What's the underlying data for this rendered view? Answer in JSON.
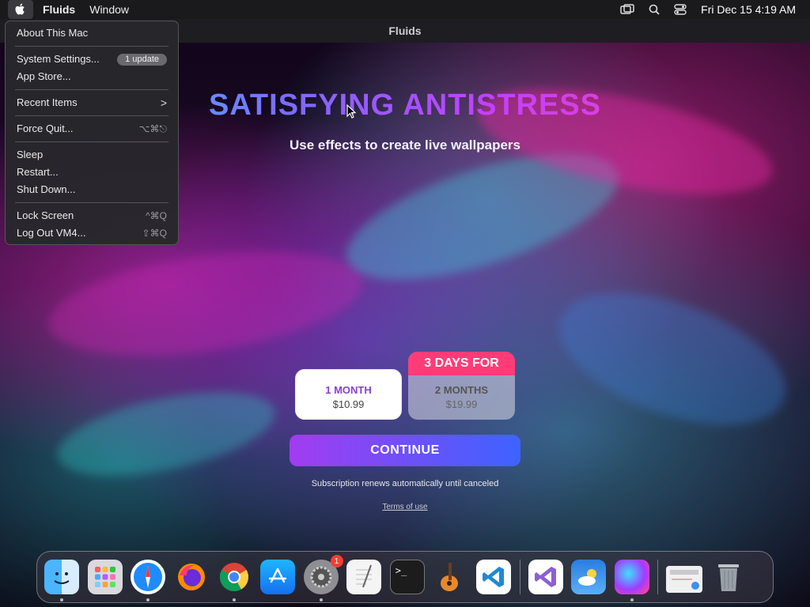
{
  "menubar": {
    "app_name": "Fluids",
    "menu_window": "Window",
    "datetime": "Fri Dec 15  4:19 AM"
  },
  "window": {
    "title": "Fluids",
    "headline": "SATISFYING ANTISTRESS",
    "subheadline": "Use effects to create live wallpapers",
    "plans": [
      {
        "title": "1 MONTH",
        "price": "$10.99",
        "selected": true
      },
      {
        "badge": "3 DAYS FOR",
        "title": "2 MONTHS",
        "price": "$19.99",
        "selected": false
      }
    ],
    "continue_label": "CONTINUE",
    "renew_note": "Subscription renews automatically until canceled",
    "terms_label": "Terms of use"
  },
  "apple_menu": {
    "items": [
      {
        "label": "About This Mac"
      },
      {
        "label": "System Settings...",
        "badge": "1 update"
      },
      {
        "label": "App Store..."
      },
      {
        "label": "Recent Items",
        "shortcut": ">"
      },
      {
        "label": "Force Quit...",
        "shortcut": "⌥⌘⎋"
      },
      {
        "label": "Sleep"
      },
      {
        "label": "Restart..."
      },
      {
        "label": "Shut Down..."
      },
      {
        "label": "Lock Screen",
        "shortcut": "^⌘Q"
      },
      {
        "label": "Log Out VM4...",
        "shortcut": "⇧⌘Q"
      }
    ]
  },
  "dock": {
    "icons": [
      "finder-icon",
      "launchpad-icon",
      "safari-icon",
      "firefox-icon",
      "chrome-icon",
      "app-store-icon",
      "system-settings-icon",
      "textedit-icon",
      "terminal-icon",
      "garageband-icon",
      "vscode-icon",
      "visual-studio-icon",
      "weather-icon",
      "fluids-icon",
      "preview-icon",
      "trash-icon"
    ],
    "system_settings_badge": "1"
  },
  "colors": {
    "accent_pink": "#ff3c78",
    "accent_purple": "#a23cf0",
    "accent_blue": "#3d63ff"
  }
}
